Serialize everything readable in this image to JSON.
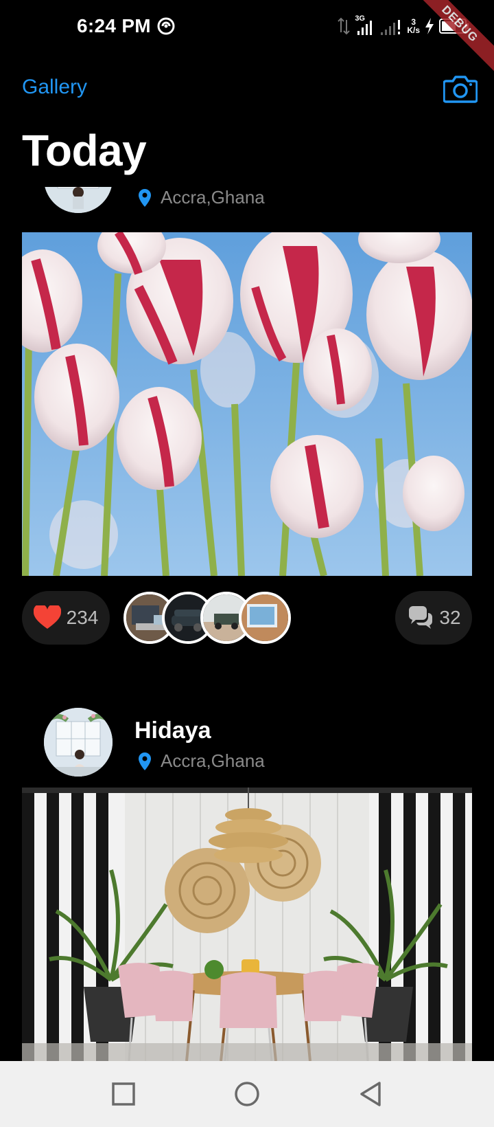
{
  "status_bar": {
    "time": "6:24 PM",
    "network_type": "3G",
    "speed_value": "3",
    "speed_unit": "K/s",
    "debug_label": "DEBUG"
  },
  "header": {
    "nav_title": "Gallery",
    "page_title": "Today",
    "camera_icon": "camera-icon"
  },
  "posts": [
    {
      "username": "",
      "location": "Accra,Ghana",
      "image_subject": "red and white tulips against blue sky",
      "likes": "234",
      "comments": "32",
      "likers": [
        "laptop-desk",
        "car-night",
        "jeep-desert",
        "tablet-workspace"
      ]
    },
    {
      "username": "Hidaya",
      "location": "Accra,Ghana",
      "image_subject": "patio dining set with pink chairs and palms"
    }
  ],
  "colors": {
    "accent": "#2196f3",
    "like": "#f44336",
    "background": "#000000",
    "pill": "#1b1b1b",
    "navbar": "#f0f0f0"
  },
  "navbar": {
    "recents_icon": "square-icon",
    "home_icon": "circle-icon",
    "back_icon": "triangle-back-icon"
  }
}
